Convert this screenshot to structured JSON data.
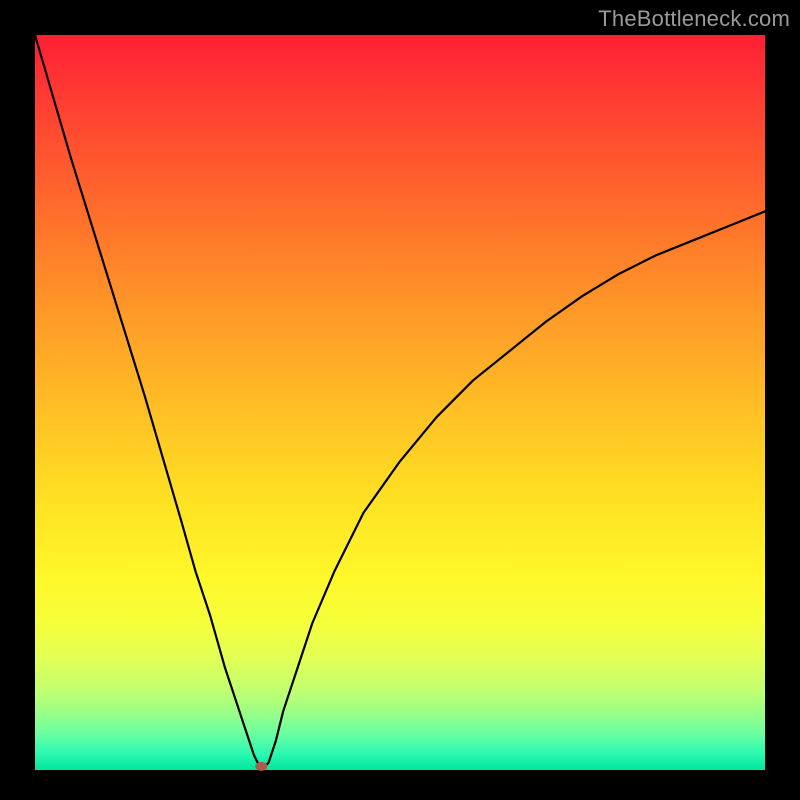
{
  "watermark": "TheBottleneck.com",
  "chart_data": {
    "type": "line",
    "title": "",
    "xlabel": "",
    "ylabel": "",
    "xlim": [
      0,
      100
    ],
    "ylim": [
      0,
      100
    ],
    "grid": false,
    "legend": false,
    "series": [
      {
        "name": "bottleneck-curve",
        "x": [
          0,
          5,
          10,
          15,
          20,
          22,
          24,
          26,
          27,
          28,
          29,
          30,
          30.5,
          31,
          31.5,
          32,
          33,
          34,
          36,
          38,
          41,
          45,
          50,
          55,
          60,
          65,
          70,
          75,
          80,
          85,
          90,
          95,
          100
        ],
        "values": [
          100,
          83,
          67,
          51,
          34,
          27,
          21,
          14,
          11,
          8,
          5,
          2,
          1,
          0.5,
          0.5,
          1,
          4,
          8,
          14,
          20,
          27,
          35,
          42,
          48,
          53,
          57,
          61,
          64.5,
          67.5,
          70,
          72,
          74,
          76
        ]
      }
    ],
    "marker": {
      "x": 31,
      "y": 0.5,
      "color": "#b25a4a"
    },
    "background_gradient": {
      "top": "#ff1f34",
      "bottom": "#00e59a"
    }
  }
}
